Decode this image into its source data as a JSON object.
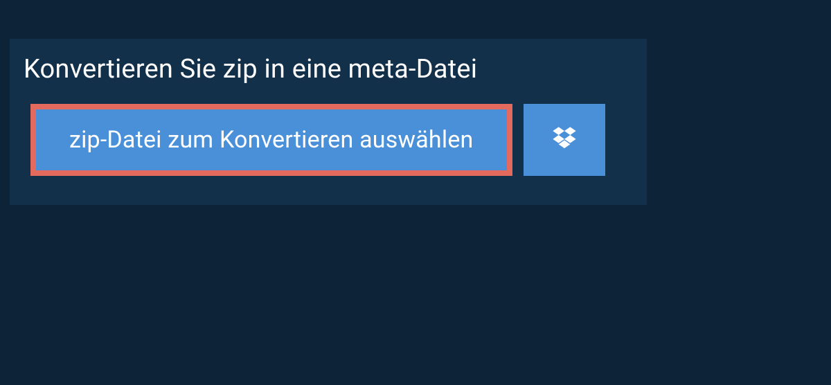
{
  "heading": "Konvertieren Sie zip in eine meta-Datei",
  "actions": {
    "select_file_label": "zip-Datei zum Konvertieren auswählen"
  },
  "colors": {
    "background": "#0d2438",
    "panel": "#13304a",
    "button": "#4a90d9",
    "highlight_border": "#e36a5c",
    "text": "#ffffff"
  }
}
